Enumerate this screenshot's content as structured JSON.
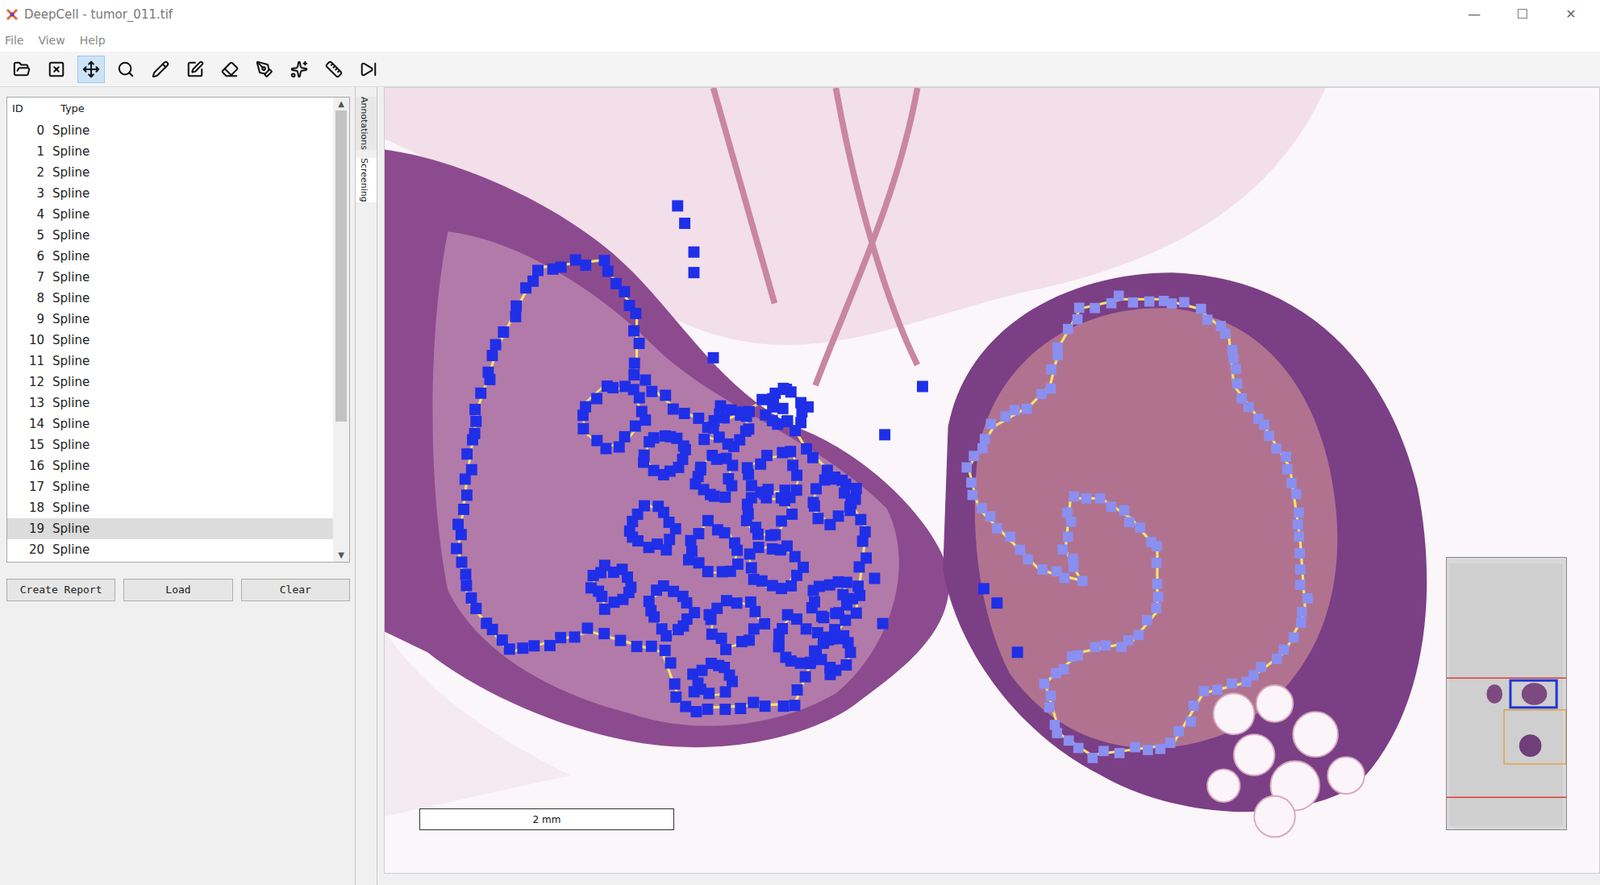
{
  "window": {
    "title": "DeepCell - tumor_011.tif",
    "controls": [
      "—",
      "☐",
      "✕"
    ]
  },
  "menu": [
    "File",
    "View",
    "Help"
  ],
  "toolbar": [
    {
      "selected": false
    },
    {
      "selected": false
    },
    {
      "selected": true
    },
    {
      "selected": false
    },
    {
      "selected": false
    },
    {
      "selected": false
    },
    {
      "selected": false
    },
    {
      "selected": false
    },
    {
      "selected": false
    },
    {
      "selected": false
    },
    {
      "selected": false
    }
  ],
  "annotations": {
    "columns": [
      "ID",
      "Type"
    ],
    "rows": [
      {
        "id": "0",
        "type": "Spline",
        "selected": false
      },
      {
        "id": "1",
        "type": "Spline",
        "selected": false
      },
      {
        "id": "2",
        "type": "Spline",
        "selected": false
      },
      {
        "id": "3",
        "type": "Spline",
        "selected": false
      },
      {
        "id": "4",
        "type": "Spline",
        "selected": false
      },
      {
        "id": "5",
        "type": "Spline",
        "selected": false
      },
      {
        "id": "6",
        "type": "Spline",
        "selected": false
      },
      {
        "id": "7",
        "type": "Spline",
        "selected": false
      },
      {
        "id": "8",
        "type": "Spline",
        "selected": false
      },
      {
        "id": "9",
        "type": "Spline",
        "selected": false
      },
      {
        "id": "10",
        "type": "Spline",
        "selected": false
      },
      {
        "id": "11",
        "type": "Spline",
        "selected": false
      },
      {
        "id": "12",
        "type": "Spline",
        "selected": false
      },
      {
        "id": "13",
        "type": "Spline",
        "selected": false
      },
      {
        "id": "14",
        "type": "Spline",
        "selected": false
      },
      {
        "id": "15",
        "type": "Spline",
        "selected": false
      },
      {
        "id": "16",
        "type": "Spline",
        "selected": false
      },
      {
        "id": "17",
        "type": "Spline",
        "selected": false
      },
      {
        "id": "18",
        "type": "Spline",
        "selected": false
      },
      {
        "id": "19",
        "type": "Spline",
        "selected": true
      },
      {
        "id": "20",
        "type": "Spline",
        "selected": false
      }
    ]
  },
  "buttons": [
    "Create Report",
    "Load",
    "Clear"
  ],
  "side_tabs": [
    {
      "label": "Annotations",
      "selected": false
    },
    {
      "label": "Screening",
      "selected": true
    }
  ],
  "scale_bar": {
    "label": "2 mm"
  }
}
